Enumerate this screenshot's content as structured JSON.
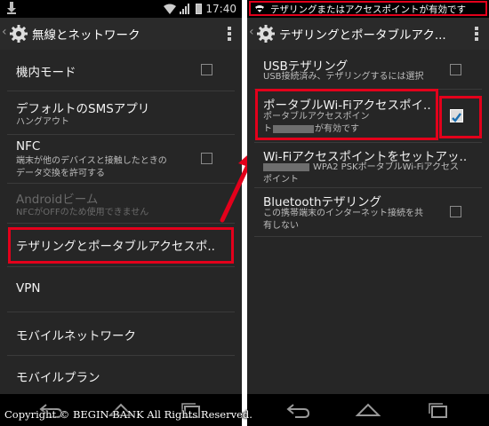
{
  "left_screen": {
    "status_bar": {
      "time": "17:40"
    },
    "action_bar": {
      "title": "無線とネットワーク"
    },
    "items": [
      {
        "title": "機内モード"
      },
      {
        "title": "デフォルトのSMSアプリ",
        "summary": "ハングアウト"
      },
      {
        "title": "NFC",
        "summary_line1": "端末が他のデバイスと接触したときの",
        "summary_line2": "データ交換を許可する"
      },
      {
        "title": "Androidビーム",
        "summary": "NFCがOFFのため使用できません"
      },
      {
        "title": "テザリングとポータブルアクセスポ.."
      },
      {
        "title": "VPN"
      },
      {
        "title": "モバイルネットワーク"
      },
      {
        "title": "モバイルプラン"
      }
    ]
  },
  "right_screen": {
    "notification": "テザリングまたはアクセスポイントが有効です",
    "action_bar": {
      "title": "テザリングとポータブルアク..."
    },
    "items": [
      {
        "title": "USBテザリング",
        "summary": "USB接続済み、テザリングするには選択"
      },
      {
        "title": "ポータブルWi-Fiアクセスポイ..",
        "summary_line1": "ポータブルアクセスポイン",
        "summary_line2_prefix": "ト",
        "summary_line2_suffix": "が有効です",
        "checked": true
      },
      {
        "title": "Wi-Fiアクセスポイントをセットアッ..",
        "summary_line1_suffix": "WPA2 PSKポータブルWi-Fiアクセス",
        "summary_line2": "ポイント"
      },
      {
        "title": "Bluetoothテザリング",
        "summary_line1": "この携帯端末のインターネット接続を共",
        "summary_line2": "有しない"
      }
    ]
  },
  "copyright": "Copyright © BEGIN BANK All Rights Reserved.",
  "colors": {
    "highlight": "#e3001b",
    "arrow": "#e3001b",
    "background": "#262626"
  }
}
